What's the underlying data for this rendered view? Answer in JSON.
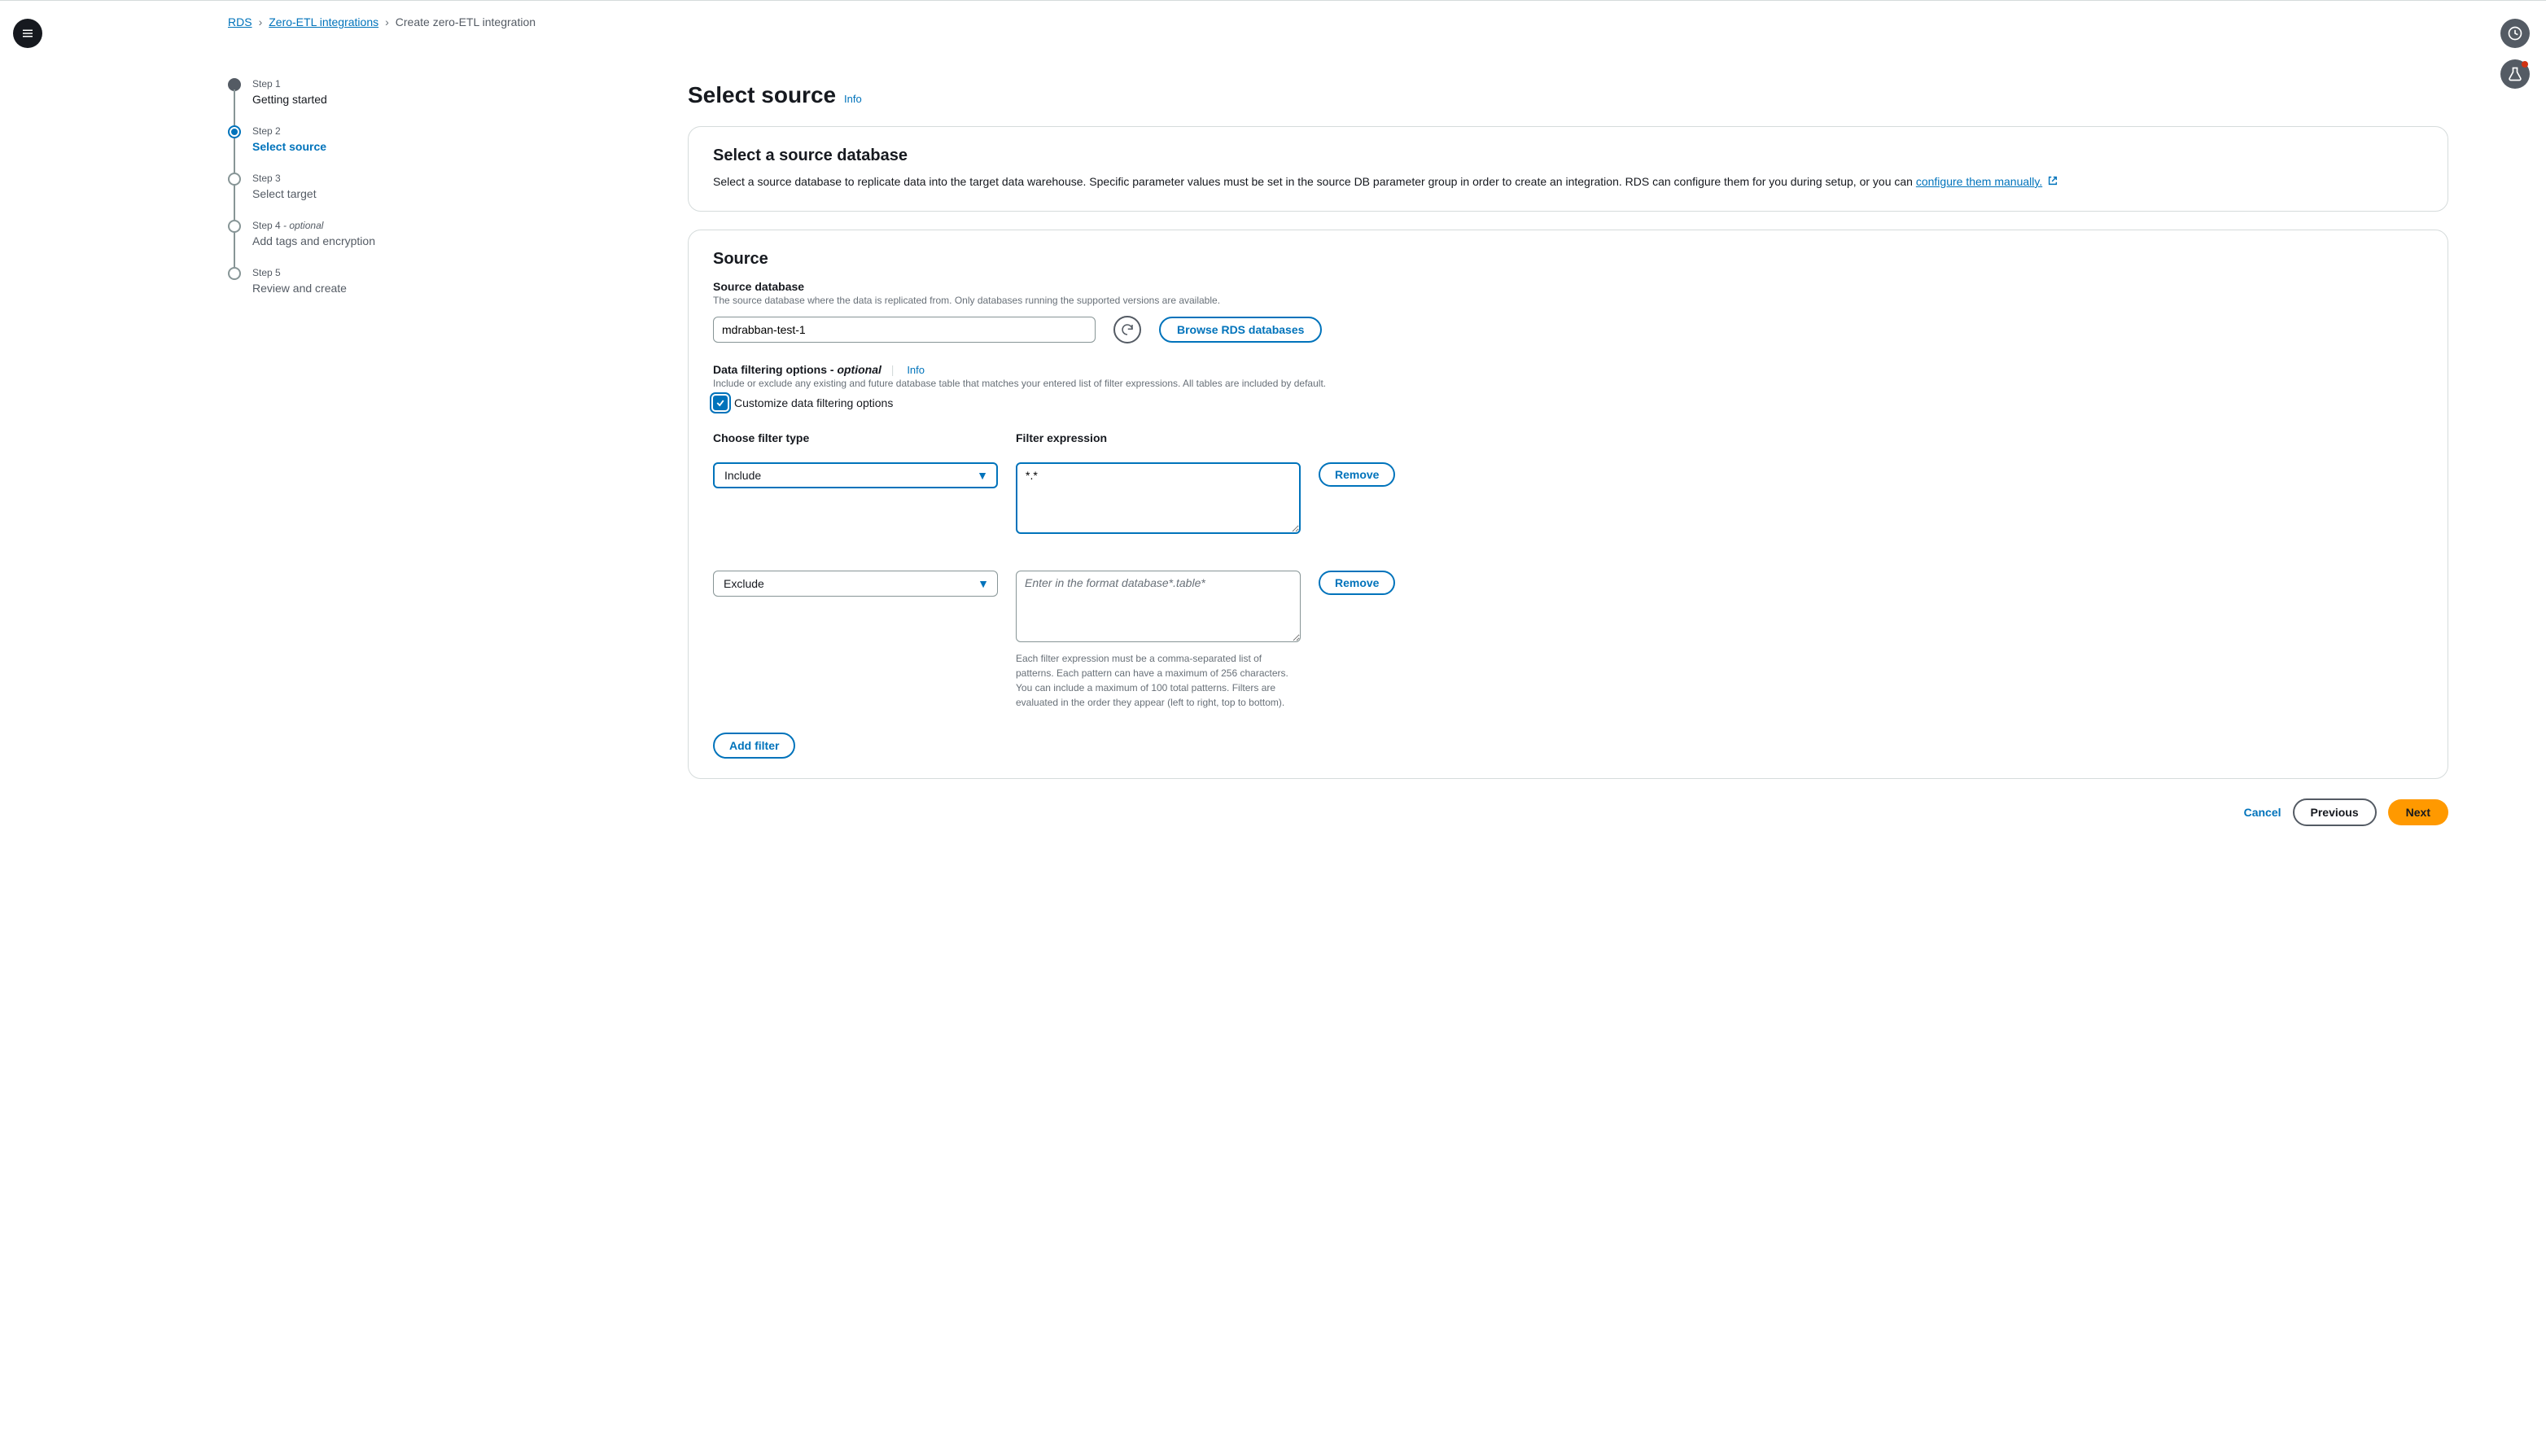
{
  "breadcrumb": {
    "items": [
      "RDS",
      "Zero-ETL integrations",
      "Create zero-ETL integration"
    ]
  },
  "steps": [
    {
      "label": "Step 1",
      "title": "Getting started"
    },
    {
      "label": "Step 2",
      "title": "Select source"
    },
    {
      "label": "Step 3",
      "title": "Select target"
    },
    {
      "label": "Step 4",
      "opt": " - optional",
      "title": "Add tags and encryption"
    },
    {
      "label": "Step 5",
      "title": "Review and create"
    }
  ],
  "header": {
    "title": "Select source",
    "info": "Info"
  },
  "panel1": {
    "title": "Select a source database",
    "desc": "Select a source database to replicate data into the target data warehouse. Specific parameter values must be set in the source DB parameter group in order to create an integration. RDS can configure them for you during setup, or you can ",
    "link": "configure them manually."
  },
  "panel2": {
    "title": "Source",
    "source_db_label": "Source database",
    "source_db_hint": "The source database where the data is replicated from. Only databases running the supported versions are available.",
    "source_db_value": "mdrabban-test-1",
    "browse_button": "Browse RDS databases",
    "filter_label": "Data filtering options - ",
    "filter_label_opt": "optional",
    "info": "Info",
    "filter_hint": "Include or exclude any existing and future database table that matches your entered list of filter expressions. All tables are included by default.",
    "checkbox_label": "Customize data filtering options",
    "col_type": "Choose filter type",
    "col_expr": "Filter expression",
    "filters": [
      {
        "type": "Include",
        "expr": "*.*"
      },
      {
        "type": "Exclude",
        "expr": ""
      }
    ],
    "expr_placeholder": "Enter in the format database*.table*",
    "remove_label": "Remove",
    "expr_help": "Each filter expression must be a comma-separated list of patterns. Each pattern can have a maximum of 256 characters. You can include a maximum of 100 total patterns. Filters are evaluated in the order they appear (left to right, top to bottom).",
    "add_filter": "Add filter"
  },
  "footer": {
    "cancel": "Cancel",
    "previous": "Previous",
    "next": "Next"
  }
}
